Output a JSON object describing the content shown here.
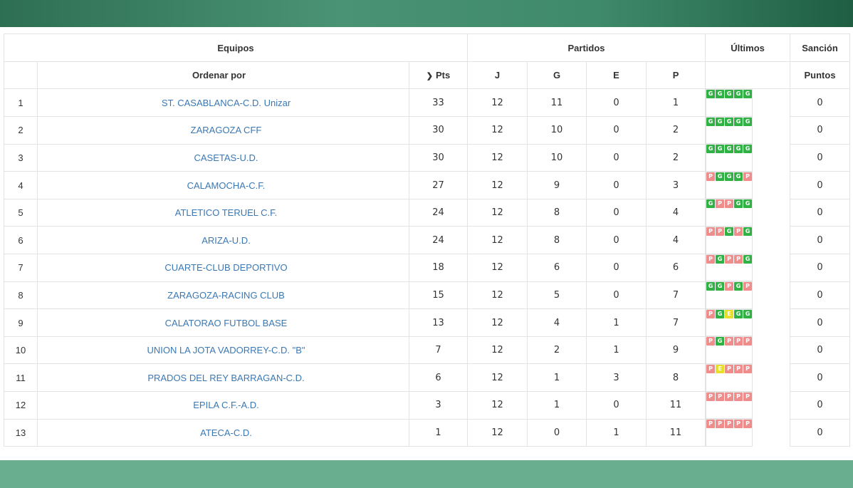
{
  "header": {
    "equipos": "Equipos",
    "partidos": "Partidos",
    "ultimos": "Últimos",
    "sancion": "Sanción",
    "ordenar_por": "Ordenar por",
    "pts": "Pts",
    "j": "J",
    "g": "G",
    "e": "E",
    "p": "P",
    "puntos": "Puntos"
  },
  "colors": {
    "win": "#2fb143",
    "loss": "#ef8c8c",
    "draw": "#e8df2a",
    "link": "#3a78b5",
    "header_bar": "#3f8a6b",
    "footer_bar": "#6aae90"
  },
  "rows": [
    {
      "rank": "1",
      "team": "ST. CASABLANCA-C.D. Unizar",
      "pts": "33",
      "j": "12",
      "g": "11",
      "e": "0",
      "p": "1",
      "form": [
        "G",
        "G",
        "G",
        "G",
        "G"
      ],
      "sancion": "0"
    },
    {
      "rank": "2",
      "team": "ZARAGOZA CFF",
      "pts": "30",
      "j": "12",
      "g": "10",
      "e": "0",
      "p": "2",
      "form": [
        "G",
        "G",
        "G",
        "G",
        "G"
      ],
      "sancion": "0"
    },
    {
      "rank": "3",
      "team": "CASETAS-U.D.",
      "pts": "30",
      "j": "12",
      "g": "10",
      "e": "0",
      "p": "2",
      "form": [
        "G",
        "G",
        "G",
        "G",
        "G"
      ],
      "sancion": "0"
    },
    {
      "rank": "4",
      "team": "CALAMOCHA-C.F.",
      "pts": "27",
      "j": "12",
      "g": "9",
      "e": "0",
      "p": "3",
      "form": [
        "P",
        "G",
        "G",
        "G",
        "P"
      ],
      "sancion": "0"
    },
    {
      "rank": "5",
      "team": "ATLETICO TERUEL C.F.",
      "pts": "24",
      "j": "12",
      "g": "8",
      "e": "0",
      "p": "4",
      "form": [
        "G",
        "P",
        "P",
        "G",
        "G"
      ],
      "sancion": "0"
    },
    {
      "rank": "6",
      "team": "ARIZA-U.D.",
      "pts": "24",
      "j": "12",
      "g": "8",
      "e": "0",
      "p": "4",
      "form": [
        "P",
        "P",
        "G",
        "P",
        "G"
      ],
      "sancion": "0"
    },
    {
      "rank": "7",
      "team": "CUARTE-CLUB DEPORTIVO",
      "pts": "18",
      "j": "12",
      "g": "6",
      "e": "0",
      "p": "6",
      "form": [
        "P",
        "G",
        "P",
        "P",
        "G"
      ],
      "sancion": "0"
    },
    {
      "rank": "8",
      "team": "ZARAGOZA-RACING CLUB",
      "pts": "15",
      "j": "12",
      "g": "5",
      "e": "0",
      "p": "7",
      "form": [
        "G",
        "G",
        "P",
        "G",
        "P"
      ],
      "sancion": "0"
    },
    {
      "rank": "9",
      "team": "CALATORAO FUTBOL BASE",
      "pts": "13",
      "j": "12",
      "g": "4",
      "e": "1",
      "p": "7",
      "form": [
        "P",
        "G",
        "E",
        "G",
        "G"
      ],
      "sancion": "0"
    },
    {
      "rank": "10",
      "team": "UNION LA JOTA VADORREY-C.D. \"B\"",
      "pts": "7",
      "j": "12",
      "g": "2",
      "e": "1",
      "p": "9",
      "form": [
        "P",
        "G",
        "P",
        "P",
        "P"
      ],
      "sancion": "0"
    },
    {
      "rank": "11",
      "team": "PRADOS DEL REY BARRAGAN-C.D.",
      "pts": "6",
      "j": "12",
      "g": "1",
      "e": "3",
      "p": "8",
      "form": [
        "P",
        "E",
        "P",
        "P",
        "P"
      ],
      "sancion": "0"
    },
    {
      "rank": "12",
      "team": "EPILA C.F.-A.D.",
      "pts": "3",
      "j": "12",
      "g": "1",
      "e": "0",
      "p": "11",
      "form": [
        "P",
        "P",
        "P",
        "P",
        "P"
      ],
      "sancion": "0"
    },
    {
      "rank": "13",
      "team": "ATECA-C.D.",
      "pts": "1",
      "j": "12",
      "g": "0",
      "e": "1",
      "p": "11",
      "form": [
        "P",
        "P",
        "P",
        "P",
        "P"
      ],
      "sancion": "0"
    }
  ]
}
